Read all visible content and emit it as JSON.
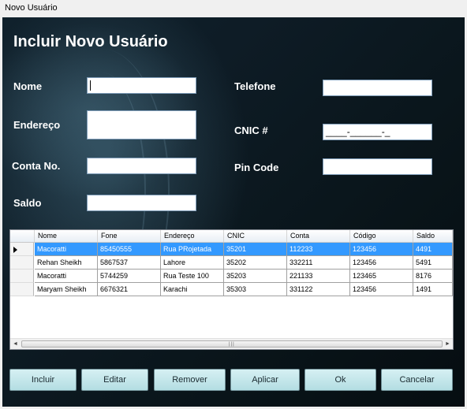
{
  "window": {
    "title": "Novo Usuário"
  },
  "form": {
    "heading": "Incluir Novo Usuário",
    "labels": {
      "nome": "Nome",
      "endereco": "Endereço",
      "conta": "Conta No.",
      "saldo": "Saldo",
      "telefone": "Telefone",
      "cnic": "CNIC #",
      "pin": "Pin Code"
    },
    "values": {
      "nome": "",
      "endereco": "",
      "conta": "",
      "saldo": "",
      "telefone": "",
      "cnic_mask": "____-______-_",
      "pin": ""
    }
  },
  "grid": {
    "columns": [
      "Nome",
      "Fone",
      "Endereço",
      "CNIC",
      "Conta",
      "Código",
      "Saldo"
    ],
    "rows": [
      [
        "Macoratti",
        "85450555",
        "Rua PRojetada",
        "35201",
        "112233",
        "123456",
        "4491"
      ],
      [
        "Rehan Sheikh",
        "5867537",
        "Lahore",
        "35202",
        "332211",
        "123456",
        "5491"
      ],
      [
        "Macoratti",
        "5744259",
        "Rua Teste 100",
        "35203",
        "221133",
        "123465",
        "8176"
      ],
      [
        "Maryam Sheikh",
        "6676321",
        "Karachi",
        "35303",
        "331122",
        "123456",
        "1491"
      ]
    ],
    "selected_row": 0,
    "scroll": {
      "left_arrow": "◄",
      "right_arrow": "►",
      "grip": "|||"
    }
  },
  "buttons": {
    "incluir": "Incluir",
    "editar": "Editar",
    "remover": "Remover",
    "aplicar": "Aplicar",
    "ok": "Ok",
    "cancelar": "Cancelar"
  }
}
